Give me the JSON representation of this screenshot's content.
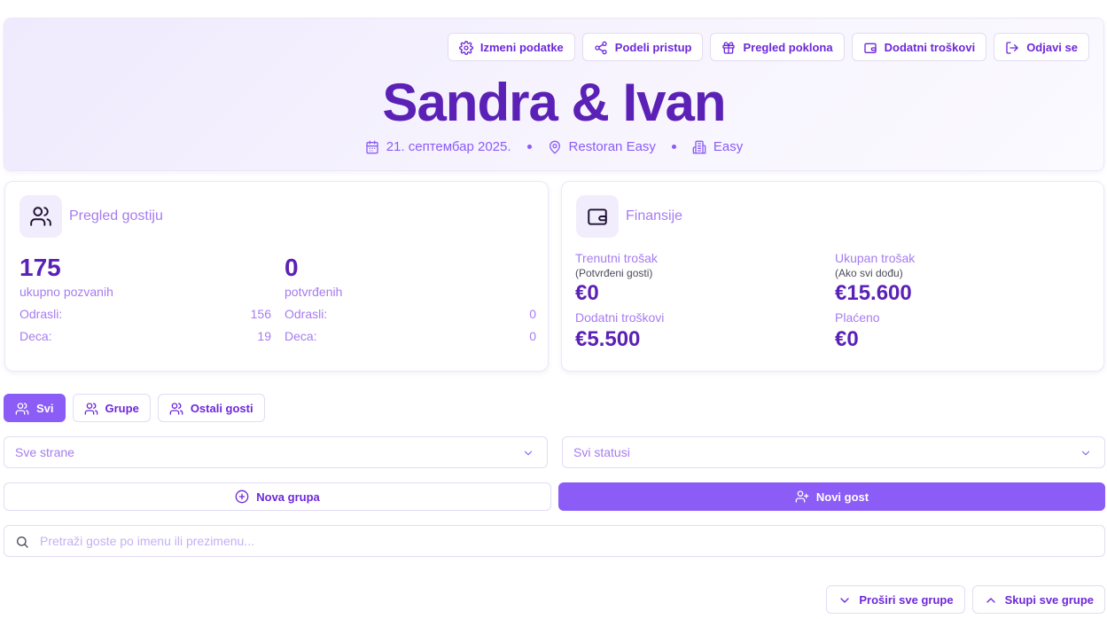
{
  "header": {
    "title": "Sandra & Ivan",
    "actions": [
      {
        "label": "Izmeni podatke",
        "icon": "gear-icon"
      },
      {
        "label": "Podeli pristup",
        "icon": "share-icon"
      },
      {
        "label": "Pregled poklona",
        "icon": "gift-icon"
      },
      {
        "label": "Dodatni troškovi",
        "icon": "wallet-icon"
      },
      {
        "label": "Odjavi se",
        "icon": "logout-icon"
      }
    ],
    "date": "21. септембар 2025.",
    "venue": "Restoran Easy",
    "hall": "Easy"
  },
  "guests": {
    "title": "Pregled gostiju",
    "invited": {
      "value": "175",
      "label": "ukupno pozvanih",
      "adults_label": "Odrasli:",
      "adults": "156",
      "kids_label": "Deca:",
      "kids": "19"
    },
    "confirmed": {
      "value": "0",
      "label": "potvrđenih",
      "adults_label": "Odrasli:",
      "adults": "0",
      "kids_label": "Deca:",
      "kids": "0"
    }
  },
  "finance": {
    "title": "Finansije",
    "current_label": "Trenutni trošak",
    "current_note": "(Potvrđeni gosti)",
    "current_value": "€0",
    "total_label": "Ukupan trošak",
    "total_note": "(Ako svi dođu)",
    "total_value": "€15.600",
    "extra_label": "Dodatni troškovi",
    "extra_value": "€5.500",
    "paid_label": "Plaćeno",
    "paid_value": "€0"
  },
  "tabs": [
    {
      "label": "Svi",
      "active": true
    },
    {
      "label": "Grupe",
      "active": false
    },
    {
      "label": "Ostali gosti",
      "active": false
    }
  ],
  "filters": {
    "side": "Sve strane",
    "status": "Svi statusi"
  },
  "buttons": {
    "new_group": "Nova grupa",
    "new_guest": "Novi gost",
    "expand_all": "Proširi sve grupe",
    "collapse_all": "Skupi sve grupe"
  },
  "search": {
    "placeholder": "Pretraži goste po imenu ili prezimenu..."
  },
  "colors": {
    "accent": "#8b5cf6",
    "heading": "#5b21b6",
    "muted": "#a67cf0"
  }
}
